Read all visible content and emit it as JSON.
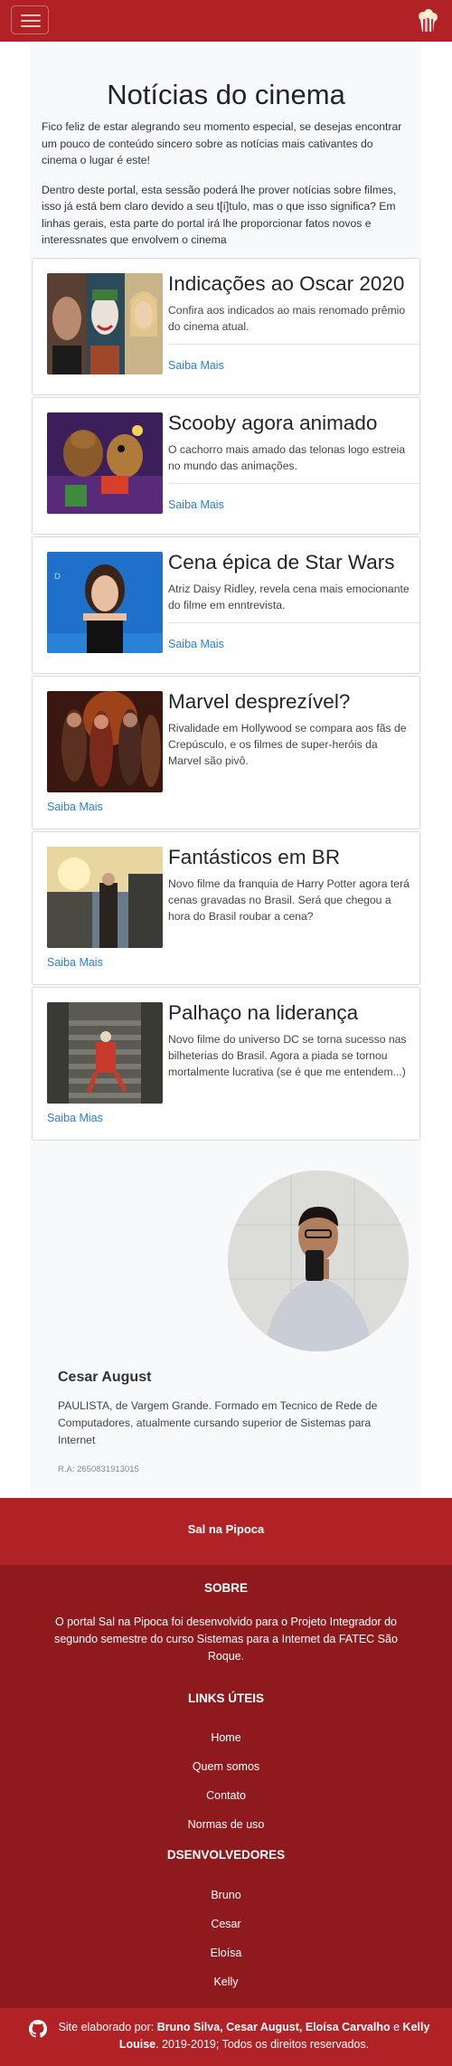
{
  "nav": {
    "menu_icon": "hamburger-icon",
    "logo_icon": "popcorn-logo-icon"
  },
  "page": {
    "title": "Notícias do cinema",
    "intro_1": "Fico feliz de estar alegrando seu momento especial, se desejas encontrar um pouco de conteúdo sincero sobre as notícias mais cativantes do cinema o lugar é este!",
    "intro_2": "Dentro deste portal, esta sessão poderá lhe prover notícias sobre filmes, isso já está bem claro devido a seu t[í]tulo, mas o que isso significa? Em linhas gerais, esta parte do portal irá lhe proporcionar fatos novos e interessnates que envolvem o cinema"
  },
  "news": [
    {
      "title": "Indicações ao Oscar 2020",
      "text": "Confira aos indicados ao mais renomado prêmio do cinema atual.",
      "link": "Saiba Mais"
    },
    {
      "title": "Scooby agora animado",
      "text": "O cachorro mais amado das telonas logo estreia no mundo das animações.",
      "link": "Saiba Mais"
    },
    {
      "title": "Cena épica de Star Wars",
      "text": "Atriz Daisy Ridley, revela cena mais emocionante do filme em enntrevista.",
      "link": "Saiba Mais"
    },
    {
      "title": "Marvel desprezível?",
      "text": "Rivalidade em Hollywood se compara aos fãs de Crepúsculo, e os filmes de super-heróis da Marvel são pivô.",
      "link": "Saiba Mais"
    },
    {
      "title": "Fantásticos em BR",
      "text": "Novo filme da franquia de Harry Potter agora terá cenas gravadas no Brasil. Será que chegou a hora do Brasil roubar a cena?",
      "link": "Saiba Mais"
    },
    {
      "title": "Palhaço na liderança",
      "text": "Novo filme do universo DC se torna sucesso nas bilheterias do Brasil. Agora a piada se tornou mortalmente lucrativa (se é que me entendem...)",
      "link": "Saiba Mias"
    }
  ],
  "profile": {
    "name": "Cesar August",
    "bio": "PAULISTA, de Vargem Grande. Formado em Tecnico de Rede de Computadores, atualmente cursando superior de Sistemas para Internet",
    "ra": "R.A: 2650831913015"
  },
  "footer": {
    "brand": "Sal na Pipoca",
    "about_title": "SOBRE",
    "about_text": "O portal Sal na Pipoca foi desenvolvido para o Projeto Integrador do segundo semestre do curso Sistemas para a Internet da FATEC São Roque.",
    "links_title": "LINKS ÚTEIS",
    "links": [
      "Home",
      "Quem somos",
      "Contato",
      "Normas de uso"
    ],
    "devs_title": "DSENVOLVEDORES",
    "devs": [
      "Bruno",
      "Cesar",
      "Eloísa",
      "Kelly"
    ],
    "credits_prefix": "Site elaborado por:",
    "credits_names_1": "Bruno Silva, Cesar August, Eloísa Carvalho",
    "credits_and": " e ",
    "credits_names_2": "Kelly Louise",
    "credits_suffix": ". 2019-2019; Todos os direitos reservados."
  },
  "colors": {
    "brand_red": "#b02226",
    "footer_red": "#8e1a1e",
    "link_blue": "#2a7ed8"
  }
}
